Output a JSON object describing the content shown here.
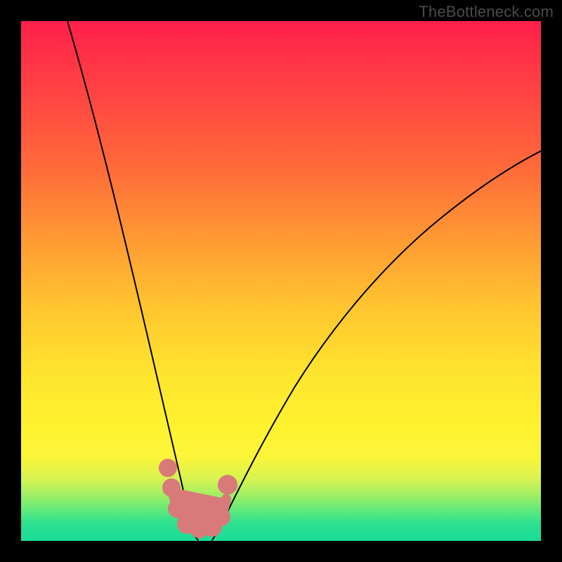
{
  "watermark": "TheBottleneck.com",
  "chart_data": {
    "type": "line",
    "title": "",
    "xlabel": "",
    "ylabel": "",
    "xlim": [
      0,
      100
    ],
    "ylim": [
      0,
      100
    ],
    "grid": false,
    "legend": false,
    "background_gradient": [
      "#ff1f4a",
      "#ff6a3a",
      "#ffc82f",
      "#fff22f",
      "#62e97a",
      "#19dc98"
    ],
    "series": [
      {
        "name": "left-curve",
        "x": [
          9,
          12,
          15,
          18,
          21,
          24,
          26,
          27.5,
          29,
          30.5,
          32
        ],
        "values": [
          100,
          88,
          74,
          60,
          46,
          32,
          22,
          15,
          10,
          6,
          3
        ]
      },
      {
        "name": "right-curve",
        "x": [
          36,
          38,
          41,
          45,
          50,
          56,
          63,
          72,
          82,
          92,
          100
        ],
        "values": [
          3,
          6,
          11,
          18,
          27,
          37,
          47,
          57,
          65,
          71,
          75
        ]
      }
    ],
    "markers": {
      "name": "highlight-points",
      "color": "#d97a7a",
      "points": [
        {
          "x": 27.5,
          "y": 14
        },
        {
          "x": 28.5,
          "y": 9
        },
        {
          "x": 30,
          "y": 5
        },
        {
          "x": 32,
          "y": 3
        },
        {
          "x": 34,
          "y": 3
        },
        {
          "x": 36,
          "y": 4
        },
        {
          "x": 37.5,
          "y": 7
        },
        {
          "x": 39,
          "y": 12
        }
      ]
    }
  }
}
